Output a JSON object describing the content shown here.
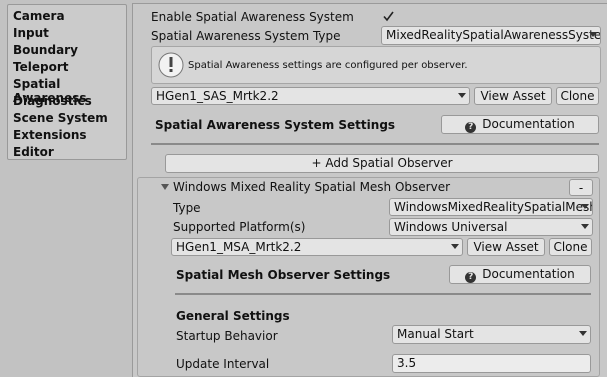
{
  "sidebar": {
    "items": [
      "Camera",
      "Input",
      "Boundary",
      "Teleport",
      "Spatial Awareness",
      "Diagnostics",
      "Scene System",
      "Extensions",
      "Editor"
    ]
  },
  "system": {
    "enable_label": "Enable Spatial Awareness System",
    "enabled": true,
    "type_label": "Spatial Awareness System Type",
    "type_value": "MixedRealitySpatialAwarenessSystem",
    "help_text": "Spatial Awareness settings are configured per observer.",
    "profile_value": "HGen1_SAS_Mrtk2.2",
    "view_asset_label": "View Asset",
    "clone_label": "Clone",
    "settings_heading": "Spatial Awareness System Settings",
    "documentation_label": "Documentation",
    "add_observer_label": "+ Add Spatial Observer"
  },
  "observer": {
    "title": "Windows Mixed Reality Spatial Mesh Observer",
    "remove_label": "-",
    "type_label": "Type",
    "type_value": "WindowsMixedRealitySpatialMeshObserver",
    "platform_label": "Supported Platform(s)",
    "platform_value": "Windows Universal",
    "profile_value": "HGen1_MSA_Mrtk2.2",
    "view_asset_label": "View Asset",
    "clone_label": "Clone",
    "settings_heading": "Spatial Mesh Observer Settings",
    "documentation_label": "Documentation",
    "general_heading": "General Settings",
    "startup_label": "Startup Behavior",
    "startup_value": "Manual Start",
    "update_interval_label": "Update Interval",
    "update_interval_value": "3.5"
  },
  "icons": {
    "checkmark": "check-icon",
    "info": "info-icon",
    "help": "help-icon",
    "foldout": "foldout-arrow-icon",
    "dropdown": "chevron-down-icon"
  },
  "colors": {
    "background": "#c2c2c2",
    "field": "#e4e4e4",
    "border": "#999999"
  }
}
